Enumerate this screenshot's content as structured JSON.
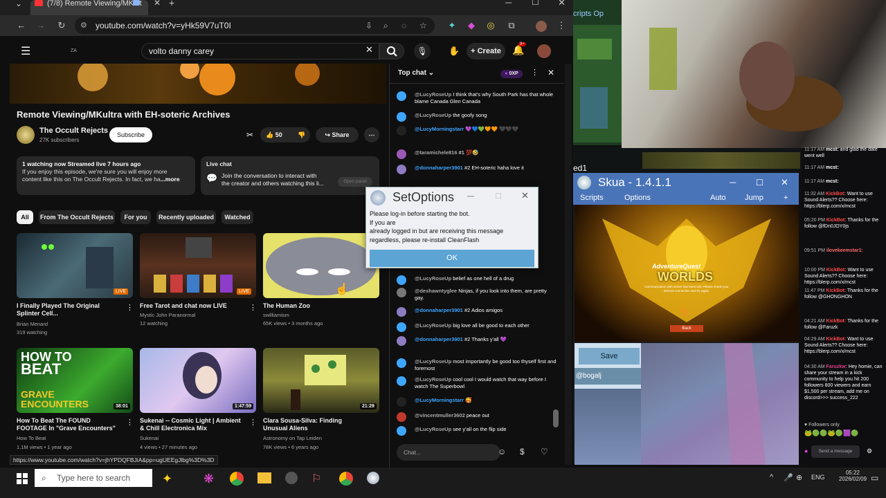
{
  "browser": {
    "tab_title": "(7/8) Remote Viewing/MKult",
    "url": "youtube.com/watch?v=yHk59V7uT0I",
    "status_url": "https://www.youtube.com/watch?v=jhYPDQFBJiA&pp=ugUEEgJlbg%3D%3D"
  },
  "yt": {
    "search_query": "volto danny carey",
    "create_label": "Create",
    "notif_count": "9+",
    "video_title": "Remote Viewing/MKultra with EH-soteric Archives",
    "channel_name": "The Occult Rejects",
    "channel_subs": "27K subscribers",
    "subscribe_label": "Subscribe",
    "like_count": "50",
    "share_label": "Share",
    "desc_line1": "1 watching now  Streamed live 7 hours ago",
    "desc_line2": "If you enjoy this episode, we're sure you will enjoy more",
    "desc_line3": "content like this on The Occult Rejects.  In fact, we ha",
    "desc_more": "...more",
    "livechat_title": "Live chat",
    "livechat_text1": "Join the conversation to interact with",
    "livechat_text2": "the creator and others watching this li...",
    "open_panel": "Open panel",
    "chips": [
      "All",
      "From The Occult Rejects",
      "For you",
      "Recently uploaded",
      "Watched"
    ],
    "cards": [
      {
        "title": "I Finally Played The Original Splinter Cell...",
        "channel": "Brian Menard",
        "meta": "319 watching",
        "badge": "LIVE"
      },
      {
        "title": "Free Tarot and chat now LIVE",
        "channel": "Mystic John Paranormal",
        "meta": "12 watching",
        "badge": "LIVE"
      },
      {
        "title": "The Human Zoo",
        "channel": "swilliamism",
        "meta": "65K views • 3 months ago",
        "badge": ""
      },
      {
        "title": "How To Beat The FOUND FOOTAGE In \"Grave Encounters\"",
        "channel": "How To Beat",
        "meta": "1.1M views • 1 year ago",
        "badge": "38:01"
      },
      {
        "title": "Sukenai -- Cosmic Light | Ambient & Chill Electronica Mix",
        "channel": "Sukenai",
        "meta": "4 views • 27 minutes ago",
        "badge": "1:47:59"
      },
      {
        "title": "Clara Sousa-Silva: Finding Unusual Aliens",
        "channel": "Astronomy on Tap Leiden",
        "meta": "78K views • 6 years ago",
        "badge": "21:29"
      }
    ],
    "thumb_text": {
      "howto1": "HOW TO",
      "howto2": "BEAT",
      "grave1": "GRAVE",
      "grave2": "ENCOUNTERS"
    }
  },
  "chat": {
    "header": "Top chat",
    "xp": "0XP",
    "placeholder": "Chat...",
    "messages": [
      {
        "name": "@LucyRoseUp",
        "text": "I think that's why South Park has that whole blame Canada Glen Canada",
        "member": false,
        "av": "#3ea6ff"
      },
      {
        "name": "@LucyRoseUp",
        "text": "the goofy song",
        "member": false,
        "av": "#3ea6ff"
      },
      {
        "name": "@LucyMorningstarr",
        "text": "💜💙💚🧡🧡 🖤🖤🖤",
        "member": true,
        "av": "#222"
      },
      {
        "name": "@taramichele816",
        "text": "#1 💯🤣",
        "member": false,
        "av": "#9b59b6"
      },
      {
        "name": "@donnaharper3901",
        "text": "#2  EH-soteric haha love it",
        "member": true,
        "av": "#8e7cc3"
      },
      {
        "name": "@LucyRoseUp",
        "text": "belief as one hell of a drug",
        "member": false,
        "av": "#3ea6ff"
      },
      {
        "name": "@deshawntyglee",
        "text": "Ninjas, if you look into them, are pretty gay.",
        "member": false,
        "av": "#777"
      },
      {
        "name": "@donnaharper3901",
        "text": "#2  Adios amigos",
        "member": true,
        "av": "#8e7cc3"
      },
      {
        "name": "@LucyRoseUp",
        "text": "big love all be good to each other",
        "member": false,
        "av": "#3ea6ff"
      },
      {
        "name": "@donnaharper3901",
        "text": "#2  Thanks y'all 💜",
        "member": true,
        "av": "#8e7cc3"
      },
      {
        "name": "@LucyRoseUp",
        "text": "most importantly be good too thyself first and foremost",
        "member": false,
        "av": "#3ea6ff"
      },
      {
        "name": "@LucyRoseUp",
        "text": "cool cool I would watch that way before I watch The Superbowl",
        "member": false,
        "av": "#3ea6ff"
      },
      {
        "name": "@LucyMorningstarr",
        "text": "🥰",
        "member": true,
        "av": "#222"
      },
      {
        "name": "@vincentmuller3602",
        "text": "peace out",
        "member": false,
        "av": "#c0392b"
      },
      {
        "name": "@LucyRoseUp",
        "text": "see y'all on the flip side",
        "member": false,
        "av": "#3ea6ff"
      }
    ]
  },
  "setoptions": {
    "title": "SetOptions",
    "line1": "Please log-in before starting the bot.",
    "line2": "If you are",
    "line3": "already logged in but are receiving this message",
    "line4": "regardless, please re-install CleanFlash",
    "ok": "OK"
  },
  "skua": {
    "title": "Skua - 1.4.1.1",
    "menu": [
      "Scripts",
      "Options",
      "Auto",
      "Jump",
      "+"
    ],
    "save": "Save",
    "user": "@bogalj",
    "game_title1": "AdventureQuest",
    "game_title2": "WORLDS",
    "game_sub": "Communication with server has been lost. Please check your internet connection and try again.",
    "back": "Back",
    "back_title": "ed1",
    "back_menu": "cripts   Op"
  },
  "right_chat": [
    {
      "t": "11:17 AM",
      "n": "mcst:",
      "m": "and glad the date went well"
    },
    {
      "t": "11:17 AM",
      "n": "mcst:",
      "m": ""
    },
    {
      "t": "11:17 AM",
      "n": "mcst:",
      "m": ""
    },
    {
      "t": "11:32 AM",
      "n": "KickBot:",
      "m": "Want to use Sound Alerts?? Choose here: https://blerp.com/x/mcst"
    },
    {
      "t": "05:20 PM",
      "n": "KickBot:",
      "m": "Thanks for the follow @fDn0JOY0js"
    },
    {
      "t": "09:51 PM",
      "n": "ilovekeemstar1:",
      "m": ""
    },
    {
      "t": "10:00 PM",
      "n": "KickBot:",
      "m": "Want to use Sound Alerts?? Choose here: https://blerp.com/x/mcst"
    },
    {
      "t": "11:47 PM",
      "n": "KickBot:",
      "m": "Thanks for the follow @GHONGHON"
    },
    {
      "t": "04:21 AM",
      "n": "KickBot:",
      "m": "Thanks for the follow @Faruzk"
    },
    {
      "t": "04:29 AM",
      "n": "KickBot:",
      "m": "Want to use Sound Alerts?? Choose here: https://blerp.com/x/mcst"
    },
    {
      "t": "04:30 AM",
      "n": "Faruzkw:",
      "m": "Hey homie, can share your stream in a kick community to help you hit 200 followers 800 viewers and earn $1,500 per stream, add me on discord>>> success_222"
    }
  ],
  "followers_only": "Followers only",
  "send_message": "Send a message",
  "taskbar": {
    "search": "Type here to search",
    "time": "05:22",
    "date": "2026/02/09",
    "lang": "ENG"
  }
}
